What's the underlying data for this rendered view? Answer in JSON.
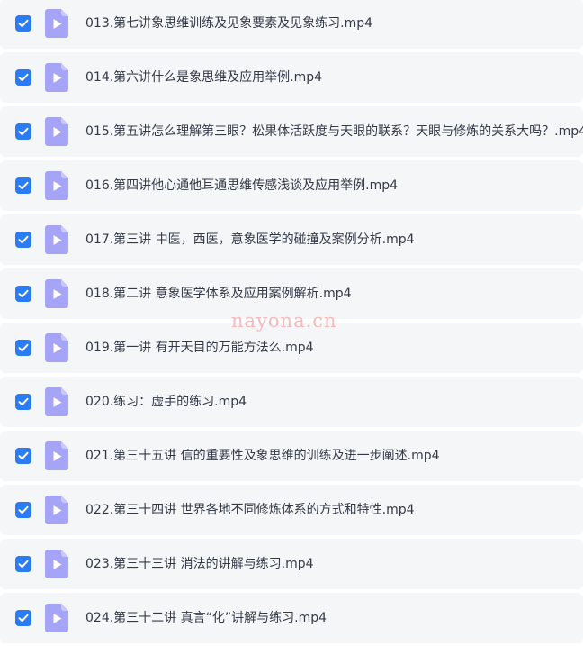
{
  "files": [
    {
      "name": "013.第七讲象思维训练及见象要素及见象练习.mp4",
      "checked": true
    },
    {
      "name": "014.第六讲什么是象思维及应用举例.mp4",
      "checked": true
    },
    {
      "name": "015.第五讲怎么理解第三眼？松果体活跃度与天眼的联系？天眼与修炼的关系大吗？.mp4",
      "checked": true
    },
    {
      "name": "016.第四讲他心通他耳通思维传感浅谈及应用举例.mp4",
      "checked": true
    },
    {
      "name": "017.第三讲 中医，西医，意象医学的碰撞及案例分析.mp4",
      "checked": true
    },
    {
      "name": "018.第二讲 意象医学体系及应用案例解析.mp4",
      "checked": true
    },
    {
      "name": "019.第一讲 有开天目的万能方法么.mp4",
      "checked": true
    },
    {
      "name": "020.练习：虚手的练习.mp4",
      "checked": true
    },
    {
      "name": "021.第三十五讲 信的重要性及象思维的训练及进一步阐述.mp4",
      "checked": true
    },
    {
      "name": "022.第三十四讲 世界各地不同修炼体系的方式和特性.mp4",
      "checked": true
    },
    {
      "name": "023.第三十三讲 消法的讲解与练习.mp4",
      "checked": true
    },
    {
      "name": "024.第三十二讲 真言“化”讲解与练习.mp4",
      "checked": true
    }
  ],
  "watermark": "nayona.cn",
  "colors": {
    "row_background": "#f5f6f8",
    "checkbox": "#2b7bf6",
    "video_icon": "#a6a4f7",
    "text": "#333a47",
    "watermark": "#f3b3b6"
  },
  "icons": {
    "checkbox": "checkmark-icon",
    "file": "video-file-icon"
  }
}
